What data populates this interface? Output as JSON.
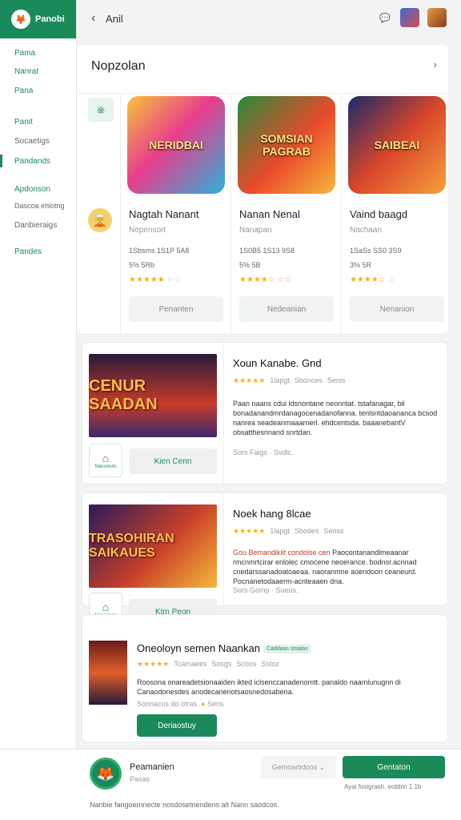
{
  "sidebar": {
    "brand": "Panobi",
    "items": [
      {
        "label": "Pama",
        "tone": "green"
      },
      {
        "label": "Nanrat",
        "tone": "green"
      },
      {
        "label": "Pana",
        "tone": "green"
      },
      {
        "label": "Panit",
        "tone": "green"
      },
      {
        "label": "Socaetigs",
        "tone": "gray"
      },
      {
        "label": "Pandands",
        "tone": "green"
      },
      {
        "label": "Apdonson",
        "tone": "green"
      },
      {
        "label": "Dascoa ehlotng",
        "tone": "gray"
      },
      {
        "label": "Danbieraigs",
        "tone": "gray"
      },
      {
        "label": "Pandes",
        "tone": "green"
      }
    ]
  },
  "topbar": {
    "title": "Anil"
  },
  "featured": {
    "title": "Nopzolan",
    "cards": [
      {
        "art": "NERIDBAI",
        "name": "Nagtah Nanant",
        "sub": "Nepensort",
        "meta1": "1Sbsms 1S1P 5A8",
        "meta2": "5% 5Rb",
        "button": "Penanten"
      },
      {
        "art": "SOMSIAN PAGRAB",
        "name": "Nanan Nenal",
        "sub": "Nanapan",
        "meta1": "1S0B5 1S13 9S8",
        "meta2": "5% 5B",
        "button": "Nedeanian"
      },
      {
        "art": "SAIBEAI",
        "name": "Vaind baagd",
        "sub": "Nachaan",
        "meta1": "1SaSs SS0 3S9",
        "meta2": "3% 5R",
        "button": "Nenanion"
      }
    ]
  },
  "list": [
    {
      "art": "CENUR SAADAN",
      "title": "Xoun Kanabe. Gnd",
      "stars_meta": [
        "1lapgt",
        "Sbonces",
        "Senis"
      ],
      "desc": "Paan naans cdui ldsnontane neonntat. tstafanagar, bil bonadanandmrdanagocenadanofanna. tenlsntdaoananca bcsod nanrea seadeanmaaarnerl. ehdcentsda. baaanebantV obsatthesnnand snrtdan.",
      "foot": "Sors Faigs · Svdlc.",
      "button": "Kien Cenn",
      "home_label": "Nansmuts"
    },
    {
      "art": "TRASOHIRAN SAIKAUES",
      "title": "Noek hang 8lcae",
      "stars_meta": [
        "1lapgt",
        "Sbodes",
        "Seoss"
      ],
      "desc": "Paocontanandlmeaanar rmcnmrtcirar enlolec cmocene neoerance. bodnsr.acnnad cnedarssanadoatoaeaa. naoranmne aoendoon ceaneurd. Pocnanetodaaerm-acnteaaen dna.",
      "desc_red": "Gou Bemandikiit condolse cen",
      "foot": "Sors Gomp · Sueus.",
      "button": "Ktm Peon",
      "home_label": "Nansmuts"
    },
    {
      "title": "Oneoloyn semen Naankan",
      "badge": "Caddaas stsalas",
      "stars_meta": [
        "Tcamaees",
        "Sosgs",
        "Scoos",
        "Sstoz"
      ],
      "desc": "Roosona onareadetsionaaiden ikted iclsenccanadenomtt. panaldo naamlunugnn di Canaodonesdes anodecanenotsaosnedosabena.",
      "foot": "Sonnacus do otras.",
      "foot2": "Sens",
      "button": "Deriaostuy"
    }
  ],
  "footer": {
    "name": "Peamanien",
    "sub": "Pasas",
    "select": "Gemoartidoos",
    "button": "Gentaton",
    "note": "Ayai fosigrash. eobbin 1 1b",
    "bottom": "Nanbie fangoernnecte nosdosetnendens alt Nann saodcos."
  }
}
